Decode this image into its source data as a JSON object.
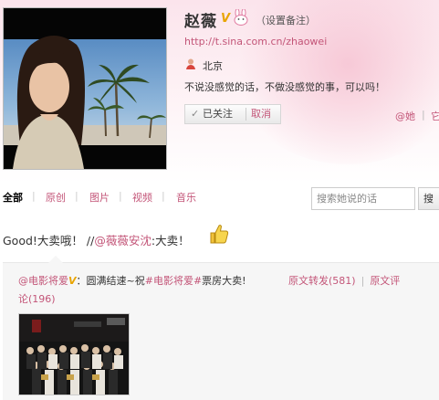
{
  "profile": {
    "name": "赵薇",
    "verified_badge": "V",
    "remark_label": "（设置备注）",
    "url": "http://t.sina.com.cn/zhaowei",
    "location": "北京",
    "bio": "不说没感觉的话，不做没感觉的事，可以吗！",
    "follow_status": "已关注",
    "cancel_label": "取消",
    "at_her_label": "@她",
    "at_separator": "|",
    "more_label": "它"
  },
  "tabs": [
    "全部",
    "原创",
    "图片",
    "视频",
    "音乐"
  ],
  "search": {
    "placeholder": "搜索她说的话",
    "button_label": "搜"
  },
  "post": {
    "text_prefix": "Good!大卖哦！",
    "repost_marker": "//",
    "mention": "@薇薇安沈",
    "text_suffix": ":大卖！"
  },
  "repost": {
    "author": "@电影将爱",
    "author_badge": "V",
    "text_part1": "：圆满结速~祝",
    "tag": "#电影将爱#",
    "text_part2": "票房大卖!",
    "repost_label": "原文转发(581)",
    "action_separator": "|",
    "comment_label_line1": "原文评",
    "comment_label_line2": "论(196)"
  },
  "colors": {
    "accent": "#c35578",
    "badge": "#e8a400",
    "header_bg": "#fbe4ec"
  }
}
